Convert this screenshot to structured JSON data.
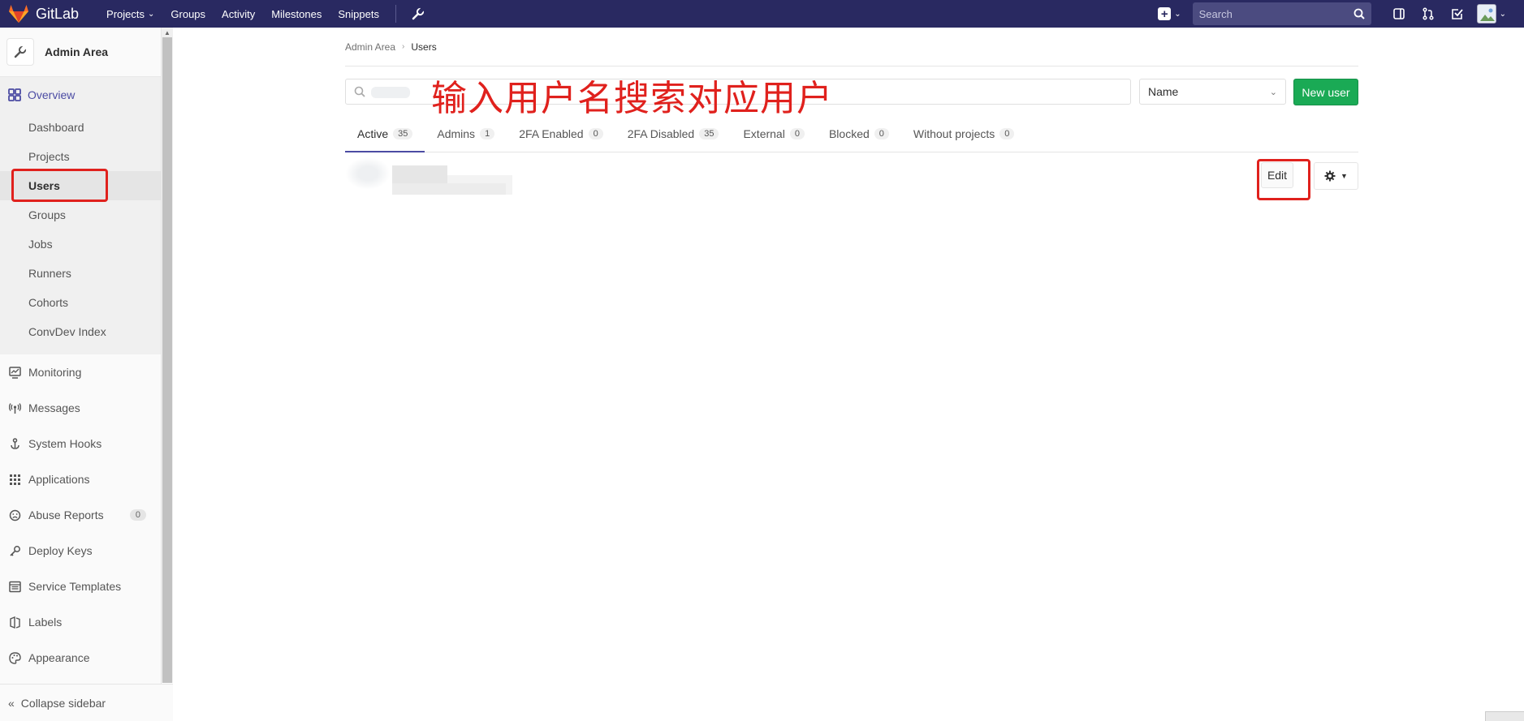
{
  "navbar": {
    "brand": "GitLab",
    "links": [
      {
        "label": "Projects",
        "dropdown": true
      },
      {
        "label": "Groups",
        "dropdown": false
      },
      {
        "label": "Activity",
        "dropdown": false
      },
      {
        "label": "Milestones",
        "dropdown": false
      },
      {
        "label": "Snippets",
        "dropdown": false
      }
    ],
    "search_placeholder": "Search"
  },
  "sidebar": {
    "context_title": "Admin Area",
    "overview_label": "Overview",
    "overview_items": [
      "Dashboard",
      "Projects",
      "Users",
      "Groups",
      "Jobs",
      "Runners",
      "Cohorts",
      "ConvDev Index"
    ],
    "active_item": "Users",
    "items": [
      {
        "label": "Monitoring",
        "icon": "monitor-icon"
      },
      {
        "label": "Messages",
        "icon": "broadcast-icon"
      },
      {
        "label": "System Hooks",
        "icon": "hook-icon"
      },
      {
        "label": "Applications",
        "icon": "apps-grid-icon"
      },
      {
        "label": "Abuse Reports",
        "icon": "abuse-icon",
        "badge": "0"
      },
      {
        "label": "Deploy Keys",
        "icon": "key-icon"
      },
      {
        "label": "Service Templates",
        "icon": "template-icon"
      },
      {
        "label": "Labels",
        "icon": "label-icon"
      },
      {
        "label": "Appearance",
        "icon": "palette-icon"
      }
    ],
    "collapse_label": "Collapse sidebar"
  },
  "breadcrumb": {
    "parent": "Admin Area",
    "current": "Users"
  },
  "annotation": "输入用户名搜索对应用户",
  "sort": {
    "selected": "Name"
  },
  "new_user_label": "New user",
  "tabs": [
    {
      "label": "Active",
      "count": "35",
      "active": true
    },
    {
      "label": "Admins",
      "count": "1"
    },
    {
      "label": "2FA Enabled",
      "count": "0"
    },
    {
      "label": "2FA Disabled",
      "count": "35"
    },
    {
      "label": "External",
      "count": "0"
    },
    {
      "label": "Blocked",
      "count": "0"
    },
    {
      "label": "Without projects",
      "count": "0"
    }
  ],
  "user_row": {
    "edit_label": "Edit"
  },
  "colors": {
    "navbar": "#292961",
    "accent": "#4b4ba3",
    "success": "#1aaa55",
    "annotation": "#e0211d"
  }
}
